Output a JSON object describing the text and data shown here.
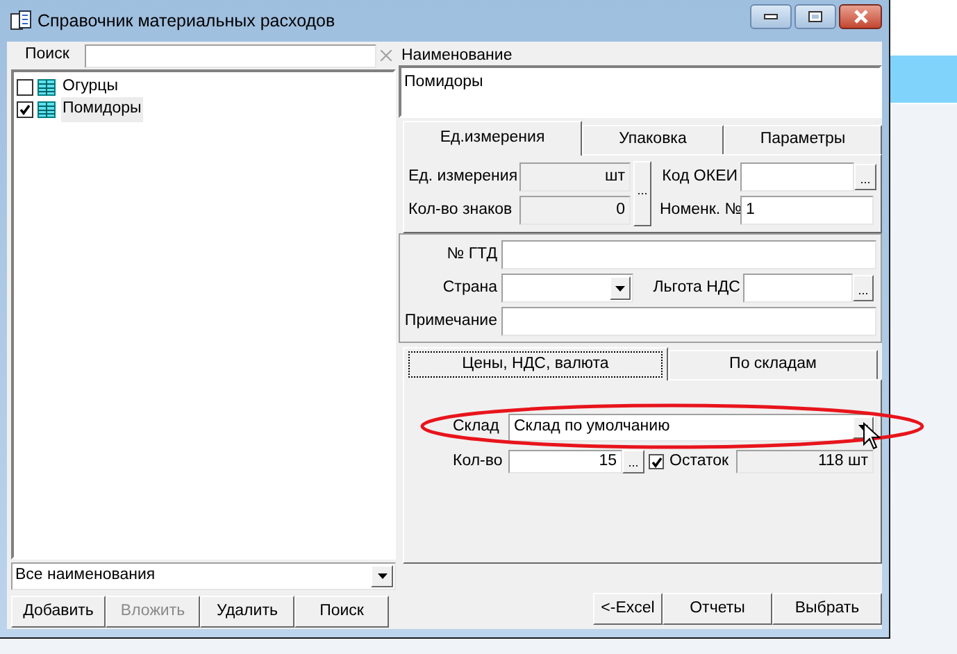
{
  "window": {
    "title": "Справочник материальных расходов"
  },
  "search": {
    "label": "Поиск"
  },
  "tree": [
    {
      "label": "Огурцы",
      "checked": false,
      "selected": false
    },
    {
      "label": "Помидоры",
      "checked": true,
      "selected": true
    }
  ],
  "filter": {
    "value": "Все наименования"
  },
  "left_buttons": [
    {
      "label": "Добавить",
      "disabled": false
    },
    {
      "label": "Вложить",
      "disabled": true
    },
    {
      "label": "Удалить",
      "disabled": false
    },
    {
      "label": "Поиск",
      "disabled": false
    }
  ],
  "name": {
    "label": "Наименование",
    "value": "Помидоры"
  },
  "tabs_top": [
    {
      "label": "Ед.измерения",
      "selected": true
    },
    {
      "label": "Упаковка",
      "selected": false
    },
    {
      "label": "Параметры",
      "selected": false
    }
  ],
  "units": {
    "unit_label": "Ед. измерения",
    "unit_value": "шт",
    "digits_label": "Кол-во знаков",
    "digits_value": "0",
    "okei_label": "Код ОКЕИ",
    "nomenk_label": "Номенк. №",
    "nomenk_value": "1"
  },
  "details": {
    "gtd_label": "№ ГТД",
    "country_label": "Страна",
    "vat_label": "Льгота НДС",
    "note_label": "Примечание"
  },
  "tabs_bottom": [
    {
      "label": "Цены, НДС, валюта",
      "selected": true
    },
    {
      "label": "По складам",
      "selected": false
    }
  ],
  "warehouse": {
    "label": "Склад",
    "value": "Склад по умолчанию",
    "qty_label": "Кол-во",
    "qty_value": "15",
    "remainder_checked": true,
    "remainder_label": "Остаток",
    "remainder_value": "118 шт"
  },
  "ellipsis": "...",
  "right_buttons": [
    {
      "label": "<-Excel"
    },
    {
      "label": "Отчеты"
    },
    {
      "label": "Выбрать"
    }
  ]
}
